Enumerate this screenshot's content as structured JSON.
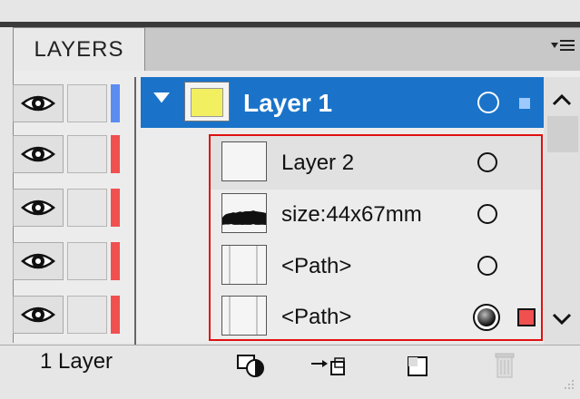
{
  "panel": {
    "tab_label": "LAYERS",
    "menu_icon": "panel-menu-icon"
  },
  "layer1": {
    "label": "Layer 1",
    "color": "#1a73c9",
    "swatch_color": "#f2f060"
  },
  "rows": [
    {
      "label": "Layer 2",
      "thumb": "blank",
      "bar_color": "#f05050",
      "target": "circle"
    },
    {
      "label": "size:44x67mm",
      "thumb": "brush-shape",
      "bar_color": "#f05050",
      "target": "circle"
    },
    {
      "label": "<Path>",
      "thumb": "lines",
      "bar_color": "#f05050",
      "target": "circle"
    },
    {
      "label": "<Path>",
      "thumb": "lines",
      "bar_color": "#f05050",
      "target": "target-selected"
    }
  ],
  "left_bars": [
    "#5b8cf0",
    "#f05050",
    "#f05050",
    "#f05050",
    "#f05050"
  ],
  "footer": {
    "count_label": "1 Layer",
    "icons": [
      "locate-object-icon",
      "move-to-layer-icon",
      "new-layer-icon",
      "trash-icon"
    ]
  },
  "colors": {
    "selection_blue": "#1a73c9",
    "highlight_red": "#e01010",
    "selected_square": "#f05050"
  }
}
